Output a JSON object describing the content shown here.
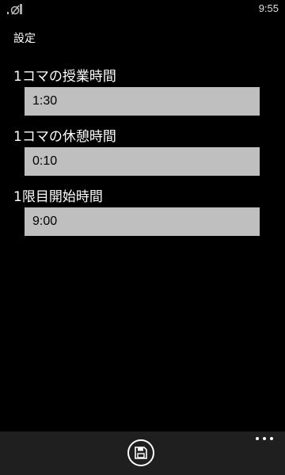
{
  "status_bar": {
    "time": "9:55",
    "icons": [
      "signal-icon",
      "no-sim-icon"
    ]
  },
  "page": {
    "title": "設定"
  },
  "fields": [
    {
      "label": "1コマの授業時間",
      "value": "1:30"
    },
    {
      "label": "1コマの休憩時間",
      "value": "0:10"
    },
    {
      "label": "1限目開始時間",
      "value": "9:00"
    }
  ],
  "app_bar": {
    "buttons": [
      "save-icon"
    ],
    "more_icon": "ellipsis-icon"
  },
  "colors": {
    "background": "#000000",
    "input_background": "#bfbfbf",
    "app_bar_background": "#1f1f1f",
    "text": "#ffffff"
  }
}
